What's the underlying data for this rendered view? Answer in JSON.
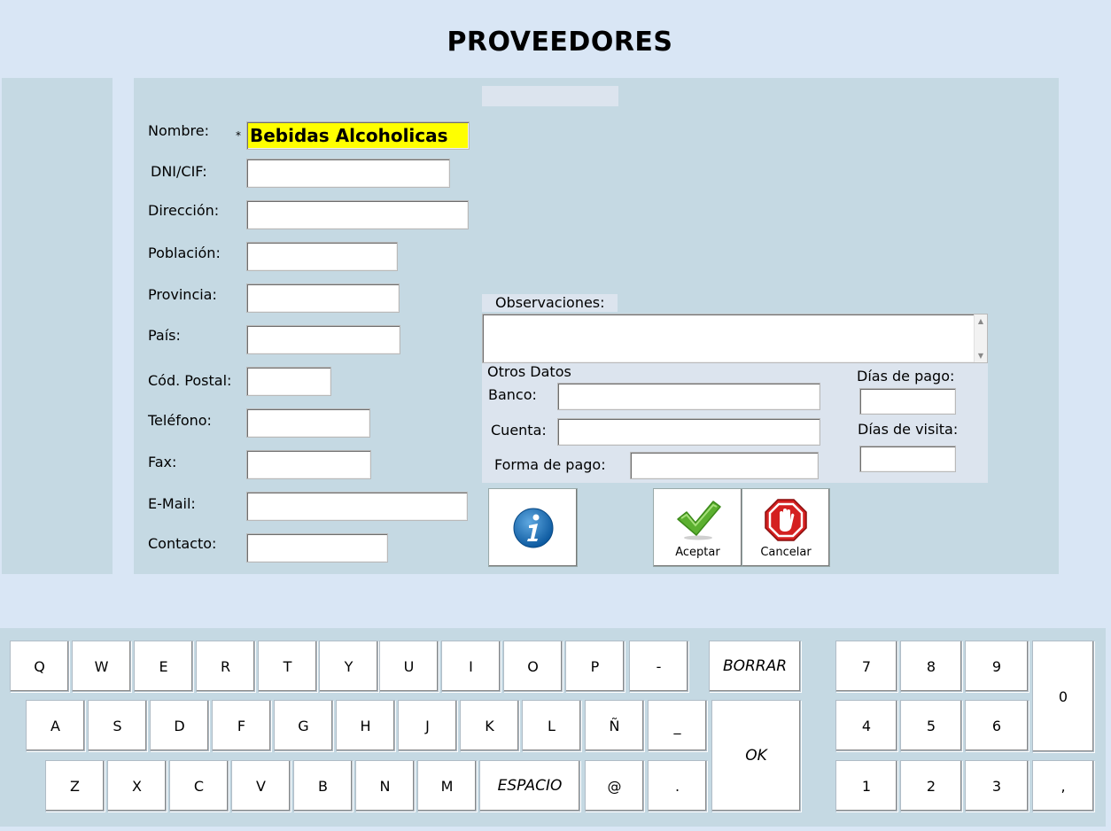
{
  "title": "PROVEEDORES",
  "form": {
    "required_mark": "*",
    "fields": [
      {
        "label": "Nombre:",
        "value": "Bebidas Alcoholicas"
      },
      {
        "label": "DNI/CIF:",
        "value": ""
      },
      {
        "label": "Dirección:",
        "value": ""
      },
      {
        "label": "Población:",
        "value": ""
      },
      {
        "label": "Provincia:",
        "value": ""
      },
      {
        "label": "País:",
        "value": ""
      },
      {
        "label": "Cód. Postal:",
        "value": ""
      },
      {
        "label": "Teléfono:",
        "value": ""
      },
      {
        "label": "Fax:",
        "value": ""
      },
      {
        "label": "E-Mail:",
        "value": ""
      },
      {
        "label": "Contacto:",
        "value": ""
      }
    ],
    "highlight_color": "#ffff00"
  },
  "observaciones": {
    "label": "Observaciones:",
    "value": "",
    "scroll_up": "▲",
    "scroll_down": "▼"
  },
  "otros": {
    "title": "Otros Datos",
    "banco": "Banco:",
    "cuenta": "Cuenta:",
    "forma_pago": "Forma de pago:",
    "dias_pago": "Días de pago:",
    "dias_visita": "Días de visita:"
  },
  "buttons": {
    "info_icon": "info-icon",
    "aceptar": "Aceptar",
    "cancelar": "Cancelar"
  },
  "keyboard": {
    "row1": [
      "Q",
      "W",
      "E",
      "R",
      "T",
      "Y",
      "U",
      "I",
      "O",
      "P",
      "-"
    ],
    "row2": [
      "A",
      "S",
      "D",
      "F",
      "G",
      "H",
      "J",
      "K",
      "L",
      "Ñ",
      "_"
    ],
    "row3": [
      "Z",
      "X",
      "C",
      "V",
      "B",
      "N",
      "M",
      "ESPACIO",
      "@",
      "."
    ],
    "borrar": "BORRAR",
    "ok": "OK",
    "numpad": [
      "7",
      "8",
      "9",
      "4",
      "5",
      "6",
      "1",
      "2",
      "3"
    ],
    "zero": "0",
    "comma": ","
  }
}
